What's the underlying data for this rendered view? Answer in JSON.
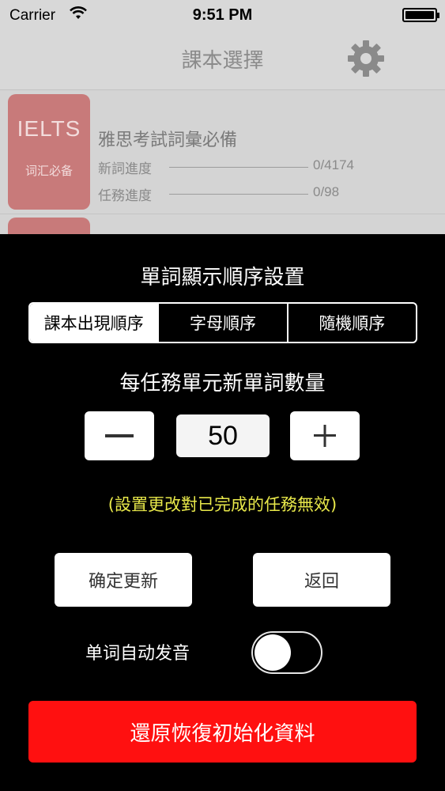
{
  "status_bar": {
    "carrier": "Carrier",
    "time": "9:51 PM",
    "icons": [
      "wifi-icon",
      "battery-icon"
    ]
  },
  "nav": {
    "title": "課本選擇",
    "settings_icon": "gear-icon"
  },
  "book": {
    "cover_title": "IELTS",
    "cover_subtitle": "词汇必备",
    "name": "雅思考試詞彙必備",
    "new_words_label": "新詞進度",
    "new_words_value": "0/4174",
    "tasks_label": "任務進度",
    "tasks_value": "0/98"
  },
  "panel": {
    "order_title": "單詞顯示順序設置",
    "order_options": [
      "課本出現順序",
      "字母順序",
      "隨機順序"
    ],
    "order_selected": "課本出現順序",
    "count_title": "每任務單元新單詞數量",
    "count_value": "50",
    "minus_icon": "minus-icon",
    "plus_icon": "plus-icon",
    "note": "(設置更改對已完成的任務無效)",
    "confirm_label": "确定更新",
    "back_label": "返回",
    "auto_pronounce_label": "单词自动发音",
    "auto_pronounce_on": false,
    "reset_label": "還原恢復初始化資料"
  },
  "colors": {
    "note_text": "#e8e84a",
    "reset_button": "#ff1010",
    "cover": "#c87a7a",
    "panel_bg": "#000000"
  }
}
